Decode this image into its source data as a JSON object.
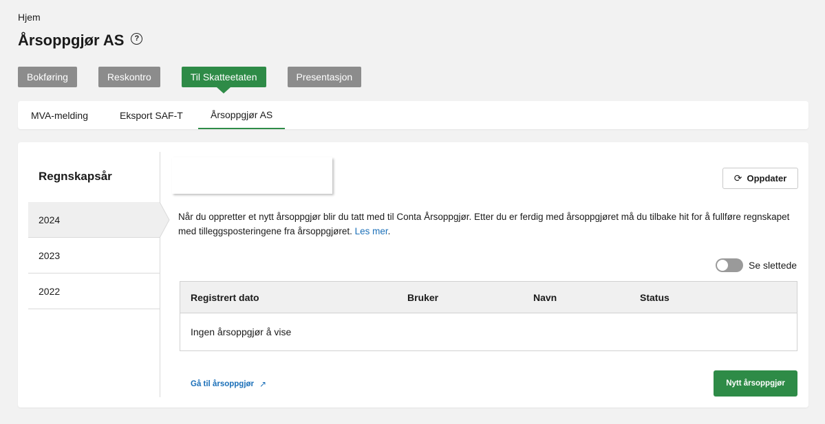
{
  "breadcrumb": {
    "home_label": "Hjem"
  },
  "page": {
    "title": "Årsoppgjør AS",
    "help_icon": "?"
  },
  "nav_buttons": [
    {
      "label": "Bokføring",
      "active": false
    },
    {
      "label": "Reskontro",
      "active": false
    },
    {
      "label": "Til Skatteetaten",
      "active": true
    },
    {
      "label": "Presentasjon",
      "active": false
    }
  ],
  "tabs": [
    {
      "label": "MVA-melding",
      "active": false
    },
    {
      "label": "Eksport SAF-T",
      "active": false
    },
    {
      "label": "Årsoppgjør AS",
      "active": true
    }
  ],
  "sidebar": {
    "heading": "Regnskapsår",
    "years": [
      {
        "label": "2024",
        "active": true
      },
      {
        "label": "2023",
        "active": false
      },
      {
        "label": "2022",
        "active": false
      }
    ]
  },
  "refresh_button": {
    "label": "Oppdater",
    "icon": "refresh-icon"
  },
  "info": {
    "text": "Når du oppretter et nytt årsoppgjør blir du tatt med til Conta Årsoppgjør. Etter du er ferdig med årsoppgjøret må du tilbake hit for å fullføre regnskapet med tilleggsposteringene fra årsoppgjøret. ",
    "link_label": "Les mer",
    "after_link": "."
  },
  "toggle": {
    "label": "Se slettede",
    "on": false
  },
  "table": {
    "columns": [
      "Registrert dato",
      "Bruker",
      "Navn",
      "Status"
    ],
    "empty_text": "Ingen årsoppgjør å vise"
  },
  "footer": {
    "goto_link_label": "Gå til årsoppgjør",
    "new_button_label": "Nytt årsoppgjør"
  },
  "colors": {
    "accent_green": "#2e8b47",
    "inactive_button": "#8c8c8c",
    "link_blue": "#1a6fb8",
    "background": "#f2f2f2"
  }
}
